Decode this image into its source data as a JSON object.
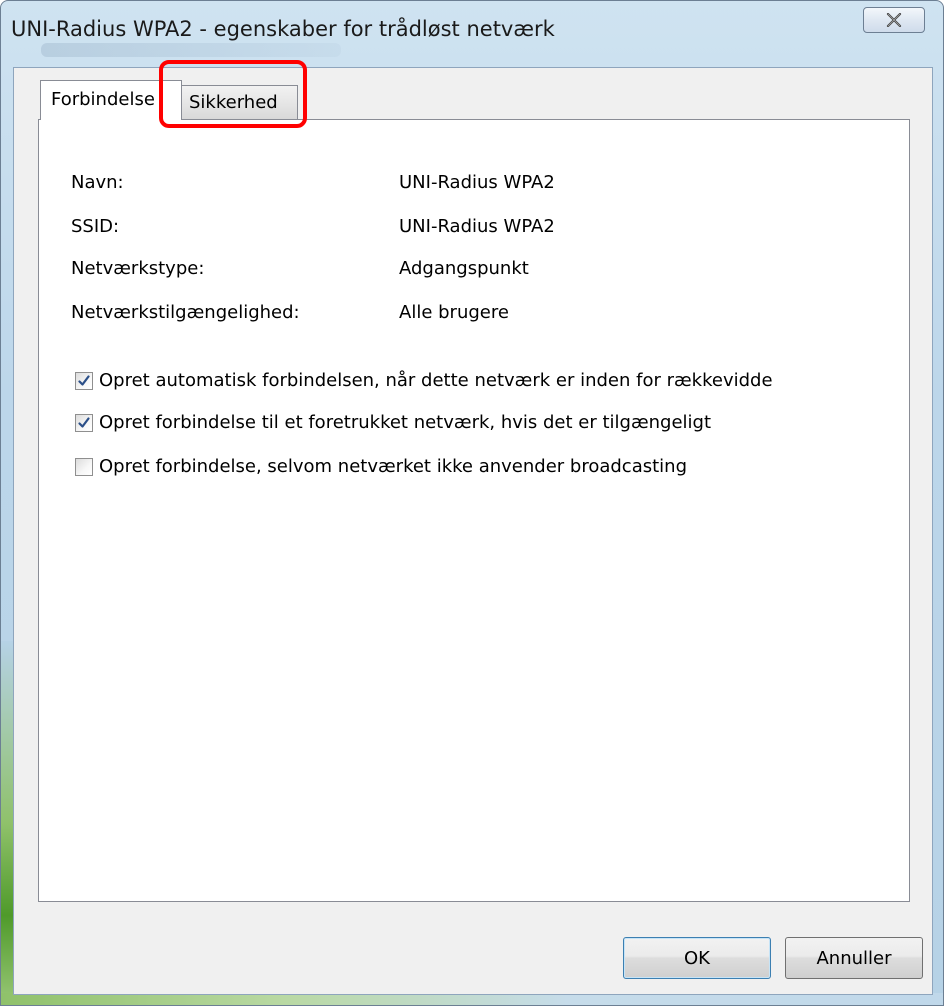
{
  "window": {
    "title": "UNI-Radius WPA2 - egenskaber for trådløst netværk"
  },
  "tabs": [
    {
      "label": "Forbindelse",
      "active": true
    },
    {
      "label": "Sikkerhed",
      "active": false,
      "highlighted": true
    }
  ],
  "info": [
    {
      "label": "Navn:",
      "value": "UNI-Radius WPA2"
    },
    {
      "label": "SSID:",
      "value": "UNI-Radius WPA2"
    },
    {
      "label": "Netværkstype:",
      "value": "Adgangspunkt"
    },
    {
      "label": "Netværkstilgængelighed:",
      "value": "Alle brugere"
    }
  ],
  "options": [
    {
      "label": "Opret automatisk forbindelsen, når dette netværk er inden for rækkevidde",
      "checked": true
    },
    {
      "label": "Opret forbindelse til et foretrukket netværk, hvis det er tilgængeligt",
      "checked": true
    },
    {
      "label": "Opret forbindelse, selvom netværket ikke anvender broadcasting",
      "checked": false
    }
  ],
  "buttons": {
    "ok": "OK",
    "cancel": "Annuller"
  },
  "icons": {
    "close": "close-icon",
    "check": "checkmark-icon"
  },
  "colors": {
    "highlight": "#ff0000",
    "frame": "#bcd6ea",
    "check": "#2b4f88"
  }
}
